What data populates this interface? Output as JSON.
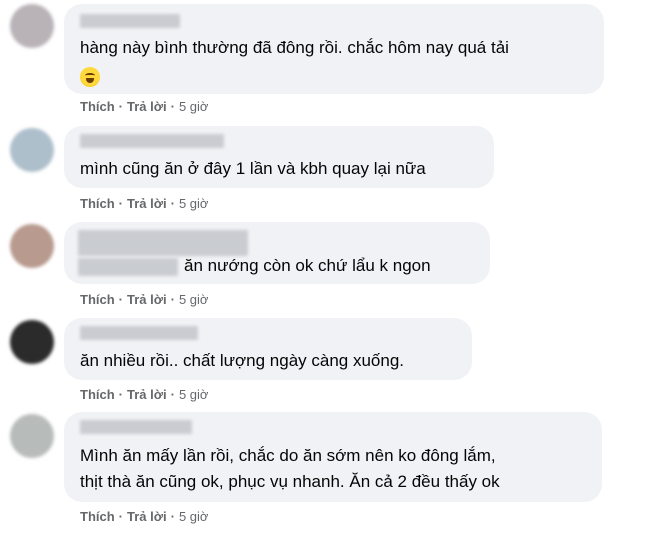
{
  "actions": {
    "like": "Thích",
    "reply": "Trả lời",
    "separator": "·"
  },
  "comments": [
    {
      "lines": [
        "hàng này bình thường đã đông rồi. chắc hôm nay quá tải"
      ],
      "has_emoji": true,
      "time": "5 giờ",
      "avatar_color": "#b9b3b8"
    },
    {
      "lines": [
        "mình cũng ăn ở đây 1 lần và kbh quay lại nữa"
      ],
      "time": "5 giờ",
      "avatar_color": "#aebfcc"
    },
    {
      "lines": [
        "ăn nướng còn ok chứ lẩu k ngon"
      ],
      "time": "5 giờ",
      "avatar_color": "#b89a8f"
    },
    {
      "lines": [
        "ăn nhiều rồi.. chất lượng ngày càng xuống."
      ],
      "time": "5 giờ",
      "avatar_color": "#2b2b2b"
    },
    {
      "lines": [
        "Mình ăn mấy lần rồi, chắc do ăn sớm nên ko đông lắm,",
        "thịt thà ăn cũng ok, phục vụ nhanh. Ăn cả 2 đều thấy ok"
      ],
      "time": "5 giờ",
      "avatar_color": "#b7bcba"
    }
  ]
}
